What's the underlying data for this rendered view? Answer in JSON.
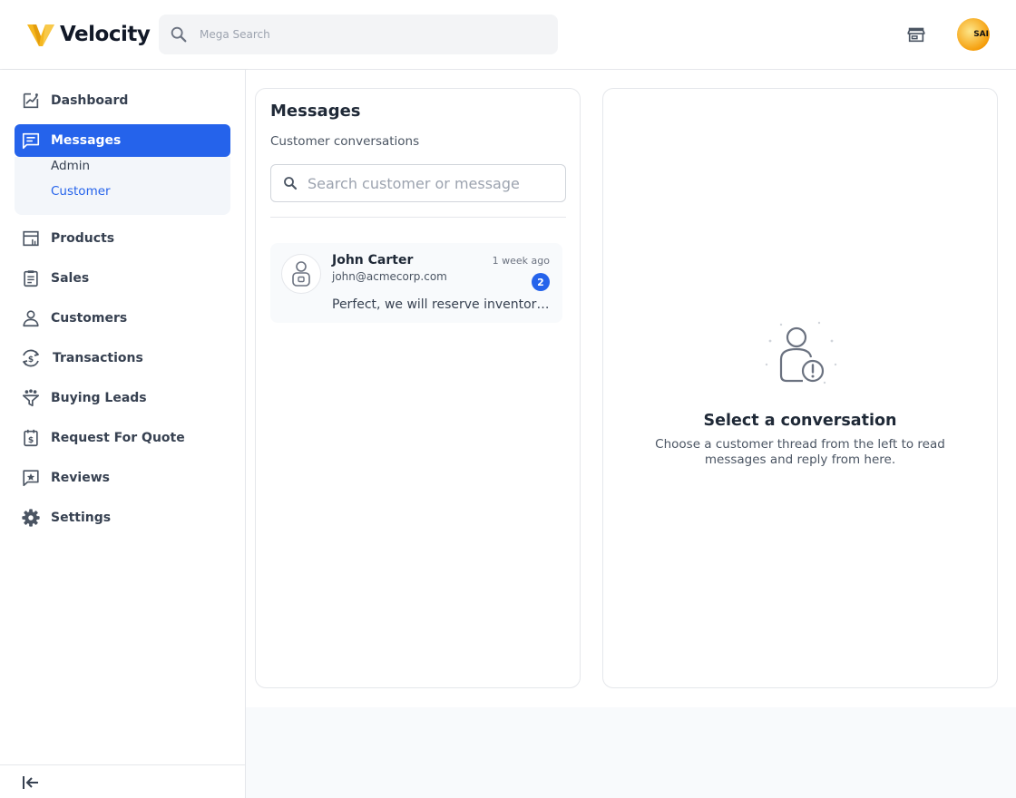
{
  "header": {
    "brand": "Velocity",
    "search": {
      "placeholder": "Mega Search",
      "value": ""
    },
    "avatar_text": "SAI"
  },
  "sidebar": {
    "items": [
      {
        "label": "Dashboard",
        "icon": "chart-line-icon"
      },
      {
        "label": "Messages",
        "icon": "message-icon",
        "active": true
      },
      {
        "label": "Products",
        "icon": "store-icon"
      },
      {
        "label": "Sales",
        "icon": "clipboard-list-icon"
      },
      {
        "label": "Customers",
        "icon": "person-icon"
      },
      {
        "label": "Transactions",
        "icon": "currency-exchange-icon"
      },
      {
        "label": "Buying Leads",
        "icon": "funnel-icon"
      },
      {
        "label": "Request For Quote",
        "icon": "quote-request-icon"
      },
      {
        "label": "Reviews",
        "icon": "review-star-icon"
      },
      {
        "label": "Settings",
        "icon": "gear-icon"
      }
    ],
    "messages_submenu": [
      {
        "label": "Admin",
        "active": false
      },
      {
        "label": "Customer",
        "active": true
      }
    ]
  },
  "messages_panel": {
    "title": "Messages",
    "subtitle": "Customer conversations",
    "search": {
      "placeholder": "Search customer or message",
      "value": ""
    },
    "conversations": [
      {
        "name": "John Carter",
        "email": "john@acmecorp.com",
        "time": "1 week ago",
        "unread": "2",
        "preview": "Perfect, we will reserve inventory for your order."
      }
    ]
  },
  "detail_panel": {
    "title": "Select a conversation",
    "description": "Choose a customer thread from the left to read messages and reply from here."
  },
  "colors": {
    "accent": "#2563eb",
    "logo_yellow": "#f5b71f",
    "text_primary": "#1f2937",
    "border": "#e5e7eb"
  }
}
